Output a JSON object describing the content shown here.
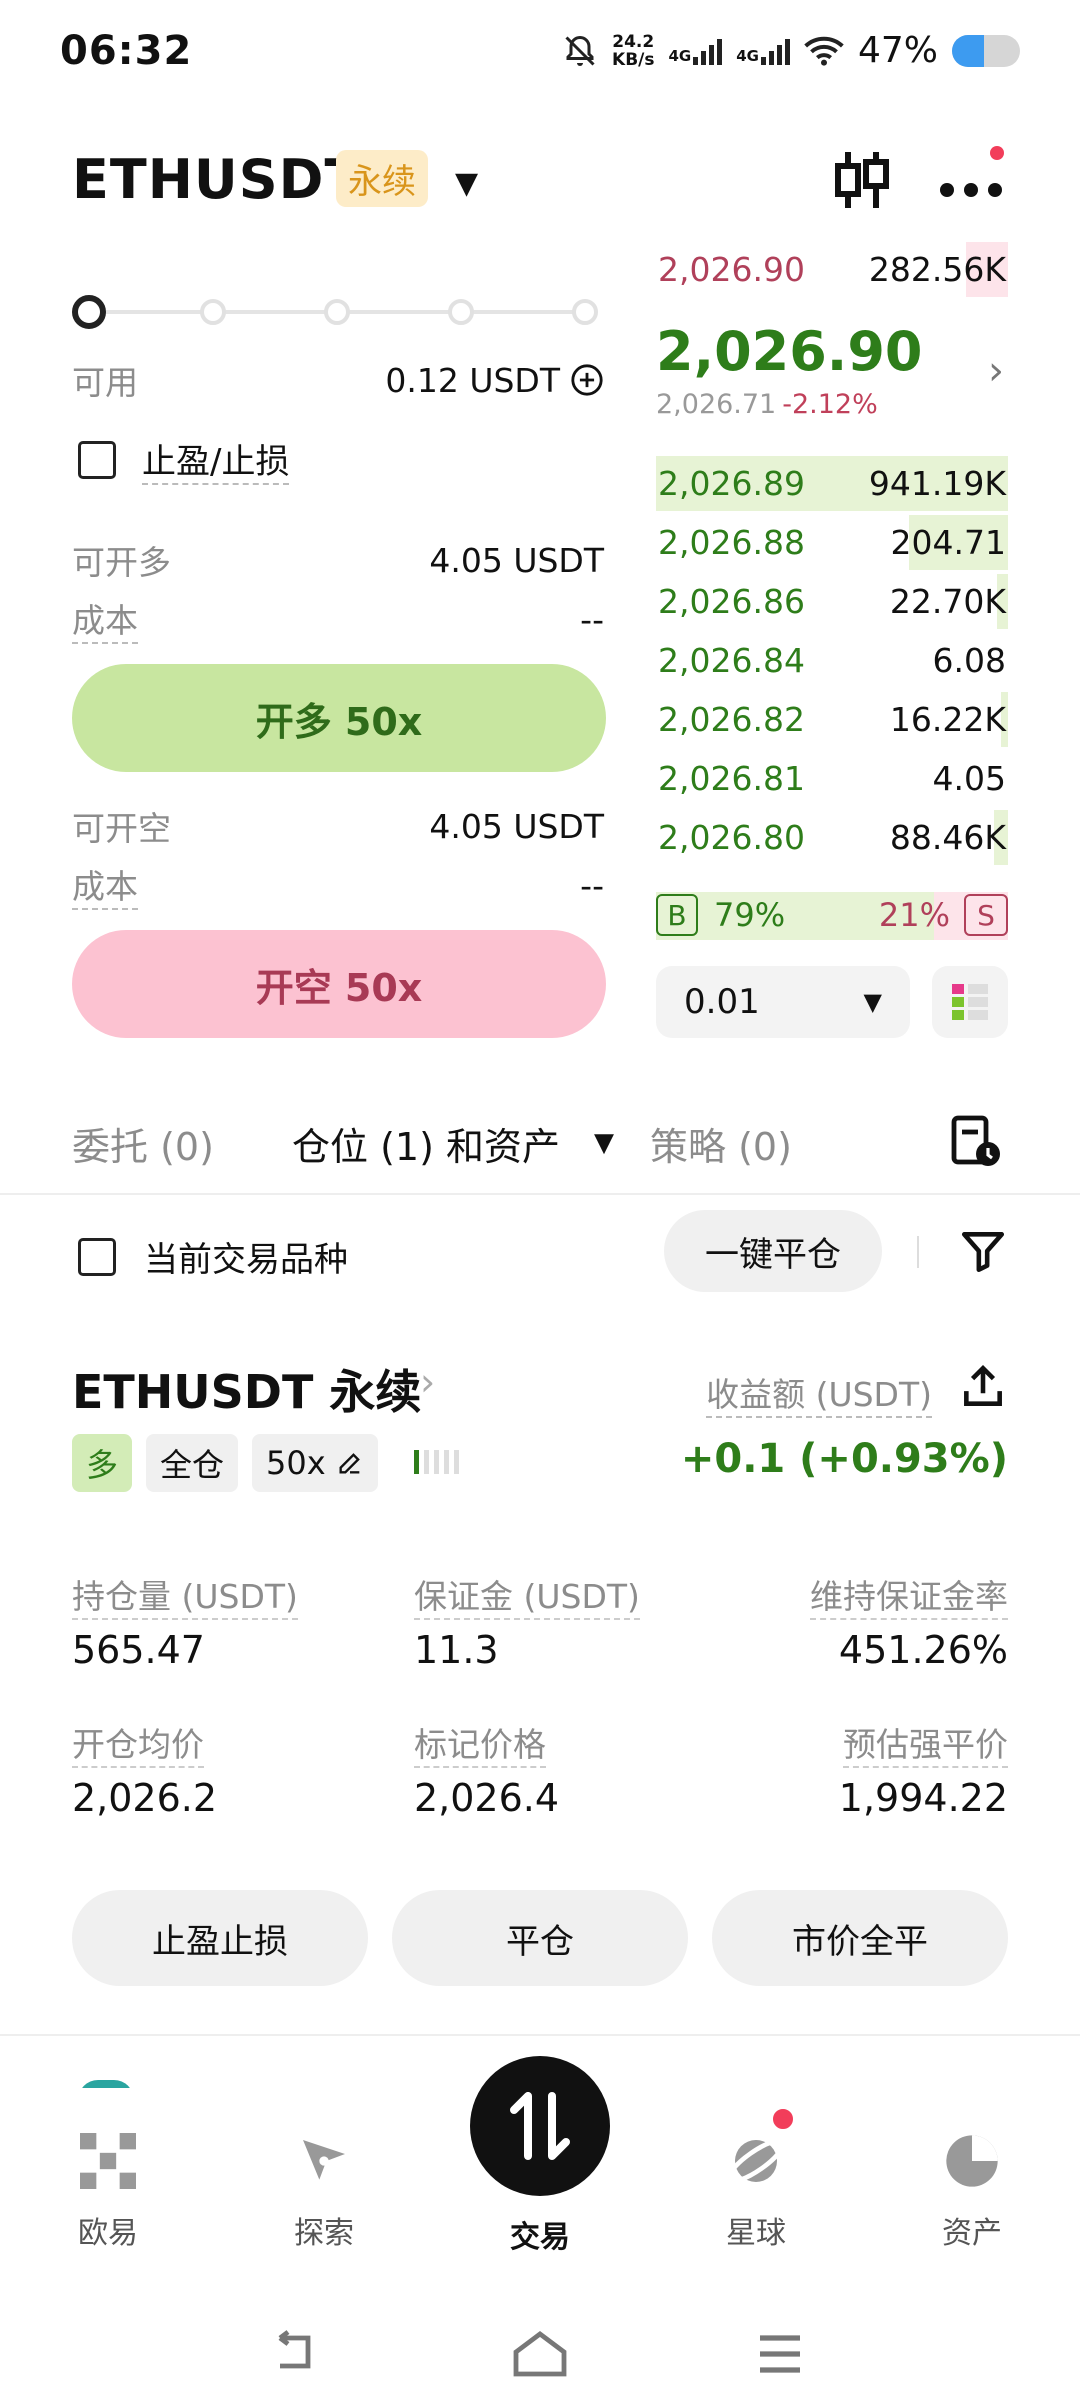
{
  "status_bar": {
    "time": "06:32",
    "net_speed_top": "24.2",
    "net_speed_bottom": "KB/s",
    "signal1": "4G",
    "signal2": "4G",
    "battery": "47%"
  },
  "header": {
    "pair": "ETHUSDT",
    "contract_type": "永续"
  },
  "order_form": {
    "available_label": "可用",
    "available_value": "0.12 USDT",
    "tpsl_label": "止盈/止损",
    "max_long_label": "可开多",
    "max_long_value": "4.05 USDT",
    "cost_label": "成本",
    "cost_long_value": "--",
    "long_button": "开多 50x",
    "max_short_label": "可开空",
    "max_short_value": "4.05 USDT",
    "cost_short_value": "--",
    "short_button": "开空 50x",
    "leverage_slider_level": 0
  },
  "order_book": {
    "top_ask": {
      "price": "2,026.90",
      "size": "282.56K",
      "depth": 0.12
    },
    "last_price": "2,026.90",
    "mark_price": "2,026.71",
    "change": "-2.12%",
    "bids": [
      {
        "price": "2,026.89",
        "size": "941.19K",
        "depth": 1.0
      },
      {
        "price": "2,026.88",
        "size": "204.71",
        "depth": 0.28
      },
      {
        "price": "2,026.86",
        "size": "22.70K",
        "depth": 0.03
      },
      {
        "price": "2,026.84",
        "size": "6.08",
        "depth": 0.0
      },
      {
        "price": "2,026.82",
        "size": "16.22K",
        "depth": 0.02
      },
      {
        "price": "2,026.81",
        "size": "4.05",
        "depth": 0.0
      },
      {
        "price": "2,026.80",
        "size": "88.46K",
        "depth": 0.04
      }
    ],
    "buy_label": "B",
    "buy_ratio": "79%",
    "sell_ratio": "21%",
    "sell_label": "S",
    "precision": "0.01"
  },
  "tabs": {
    "orders": "委托 (0)",
    "positions": "仓位 (1) 和资产",
    "strategies": "策略 (0)"
  },
  "filter": {
    "current_symbol_label": "当前交易品种",
    "close_all_button": "一键平仓"
  },
  "position": {
    "title": "ETHUSDT 永续",
    "pnl_label": "收益额 (USDT)",
    "side_tag": "多",
    "margin_mode_tag": "全仓",
    "leverage_tag": "50x",
    "pnl_value": "+0.1 (+0.93%)",
    "stats": {
      "size_label": "持仓量 (USDT)",
      "size_value": "565.47",
      "margin_label": "保证金 (USDT)",
      "margin_value": "11.3",
      "mmr_label": "维持保证金率",
      "mmr_value": "451.26%",
      "entry_label": "开仓均价",
      "entry_value": "2,026.2",
      "mark_label": "标记价格",
      "mark_value": "2,026.4",
      "liq_label": "预估强平价",
      "liq_value": "1,994.22"
    },
    "actions": {
      "tpsl": "止盈止损",
      "close": "平仓",
      "market_close": "市价全平"
    }
  },
  "bottom_nav": {
    "items": [
      "欧易",
      "探索",
      "交易",
      "星球",
      "资产"
    ]
  },
  "colors": {
    "buy_green": "#2e7d1a",
    "sell_red": "#b0405a",
    "long_button_bg": "#c8e6a0",
    "short_button_bg": "#fcc2d1",
    "perp_badge": "#d9951b"
  }
}
